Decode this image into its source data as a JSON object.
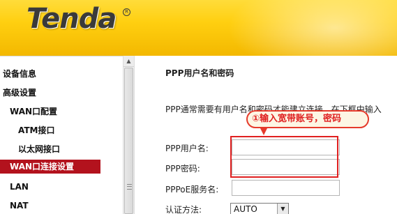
{
  "header": {
    "logo": "Tenda",
    "logo_mark": "R",
    "brand_color": "#ffcf10"
  },
  "sidebar": {
    "items": [
      {
        "label": "设备信息"
      },
      {
        "label": "高级设置"
      },
      {
        "label": "WAN口配置"
      },
      {
        "label": "ATM接口"
      },
      {
        "label": "以太网接口"
      },
      {
        "label": "WAN口连接设置",
        "active": true
      },
      {
        "label": "LAN"
      },
      {
        "label": "NAT"
      }
    ],
    "active_color": "#b3121d"
  },
  "main": {
    "section_title": "PPP用户名和密码",
    "description": "PPP通常需要有用户名和密码才能建立连接。在下框中输入",
    "fields": {
      "username_label": "PPP用户名:",
      "username_value": "",
      "password_label": "PPP密码:",
      "password_value": "",
      "service_label": "PPPoE服务名:",
      "service_value": "",
      "auth_label": "认证方法:",
      "auth_value": "AUTO"
    }
  },
  "annotation": {
    "callout_text": "①输入宽带账号，密码",
    "color": "#e02020"
  }
}
